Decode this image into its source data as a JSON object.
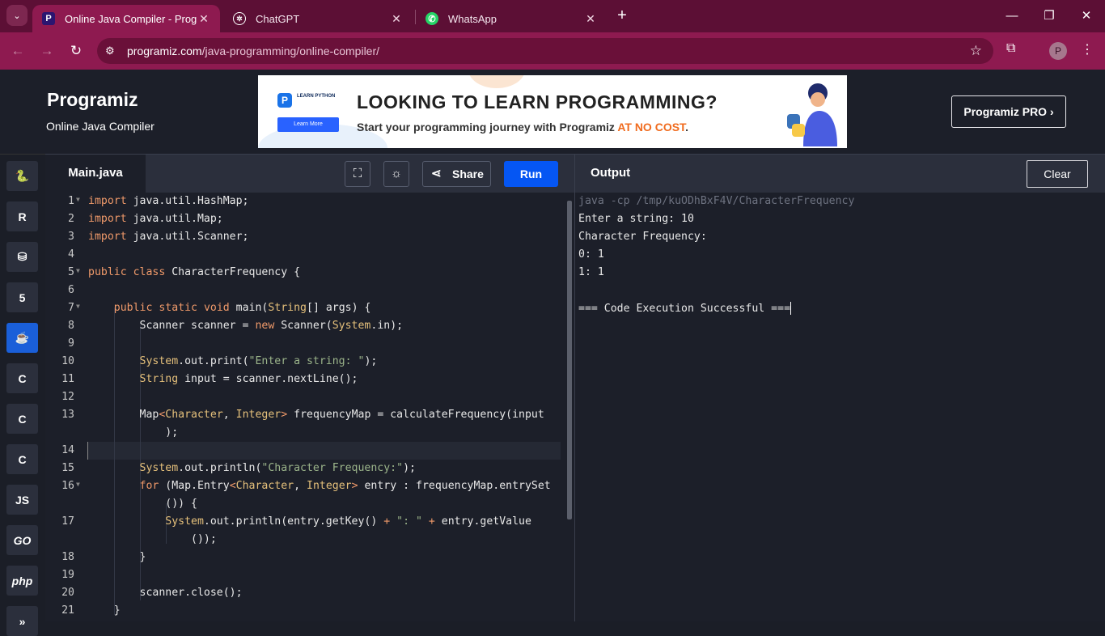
{
  "browser": {
    "tabs": [
      {
        "title": "Online Java Compiler - Programiz",
        "active": true,
        "icon": "programiz-icon"
      },
      {
        "title": "ChatGPT",
        "active": false,
        "icon": "chatgpt-icon"
      },
      {
        "title": "WhatsApp",
        "active": false,
        "icon": "whatsapp-icon"
      }
    ],
    "url_host": "programiz.com",
    "url_path": "/java-programming/online-compiler/",
    "profile_initial": "P",
    "colors": {
      "frame": "#5c0f35",
      "toolbar": "#8e1a50",
      "omnibox": "#6a1039"
    }
  },
  "header": {
    "logo": "Programiz",
    "subtitle": "Online Java Compiler",
    "pro_button": "Programiz PRO ›",
    "banner": {
      "card_title": "LEARN PYTHON",
      "card_button": "Learn More",
      "headline": "LOOKING TO LEARN PROGRAMMING?",
      "sub_prefix": "Start your programming journey with Programiz ",
      "sub_highlight": "AT NO COST",
      "sub_suffix": ".",
      "highlight_color": "#f06b1e"
    }
  },
  "sidebar": {
    "languages": [
      {
        "name": "python",
        "glyph": "🐍"
      },
      {
        "name": "r",
        "glyph": "R"
      },
      {
        "name": "sql",
        "glyph": "⛁"
      },
      {
        "name": "html",
        "glyph": "5"
      },
      {
        "name": "java",
        "glyph": "☕",
        "active": true
      },
      {
        "name": "c",
        "glyph": "C"
      },
      {
        "name": "cpp",
        "glyph": "C"
      },
      {
        "name": "csharp",
        "glyph": "C"
      },
      {
        "name": "js",
        "glyph": "JS"
      },
      {
        "name": "go",
        "glyph": "GO"
      },
      {
        "name": "php",
        "glyph": "php"
      },
      {
        "name": "swift",
        "glyph": "»"
      }
    ],
    "active_color": "#1a5fd9"
  },
  "editor": {
    "file_tab": "Main.java",
    "share_label": "Share",
    "run_label": "Run",
    "run_color": "#0556f3"
  },
  "output": {
    "title": "Output",
    "clear_label": "Clear",
    "command": "java -cp /tmp/kuODhBxF4V/CharacterFrequency",
    "lines": [
      "Enter a string: 10",
      "Character Frequency:",
      "0: 1",
      "1: 1",
      "",
      "=== Code Execution Successful ==="
    ]
  }
}
